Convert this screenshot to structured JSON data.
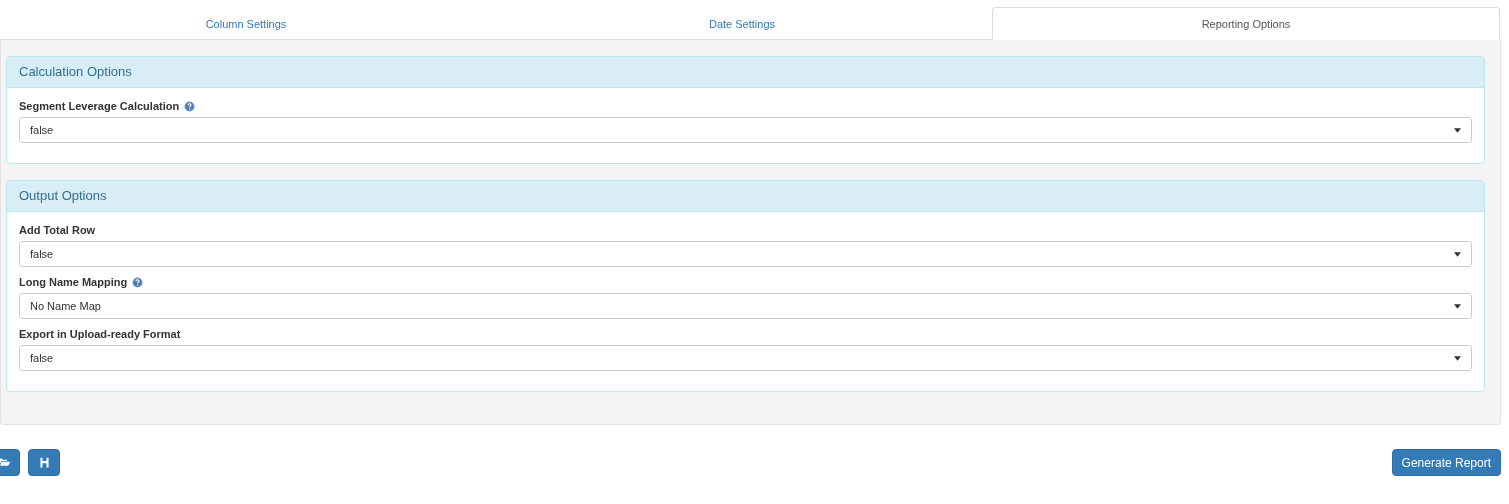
{
  "tabs": [
    {
      "label": "Column Settings",
      "selected": false
    },
    {
      "label": "Date Settings",
      "selected": false
    },
    {
      "label": "Reporting Options",
      "selected": true
    }
  ],
  "panels": [
    {
      "title": "Calculation Options",
      "fields": [
        {
          "label": "Segment Leverage Calculation",
          "help": true,
          "value": "false"
        }
      ]
    },
    {
      "title": "Output Options",
      "fields": [
        {
          "label": "Add Total Row",
          "help": false,
          "value": "false"
        },
        {
          "label": "Long Name Mapping",
          "help": true,
          "value": "No Name Map"
        },
        {
          "label": "Export in Upload-ready Format",
          "help": false,
          "value": "false"
        }
      ]
    }
  ],
  "toolbar": {
    "icon_buttons": [
      {
        "kind": "open"
      },
      {
        "kind": "save"
      }
    ],
    "primary_button": "Generate Report"
  }
}
